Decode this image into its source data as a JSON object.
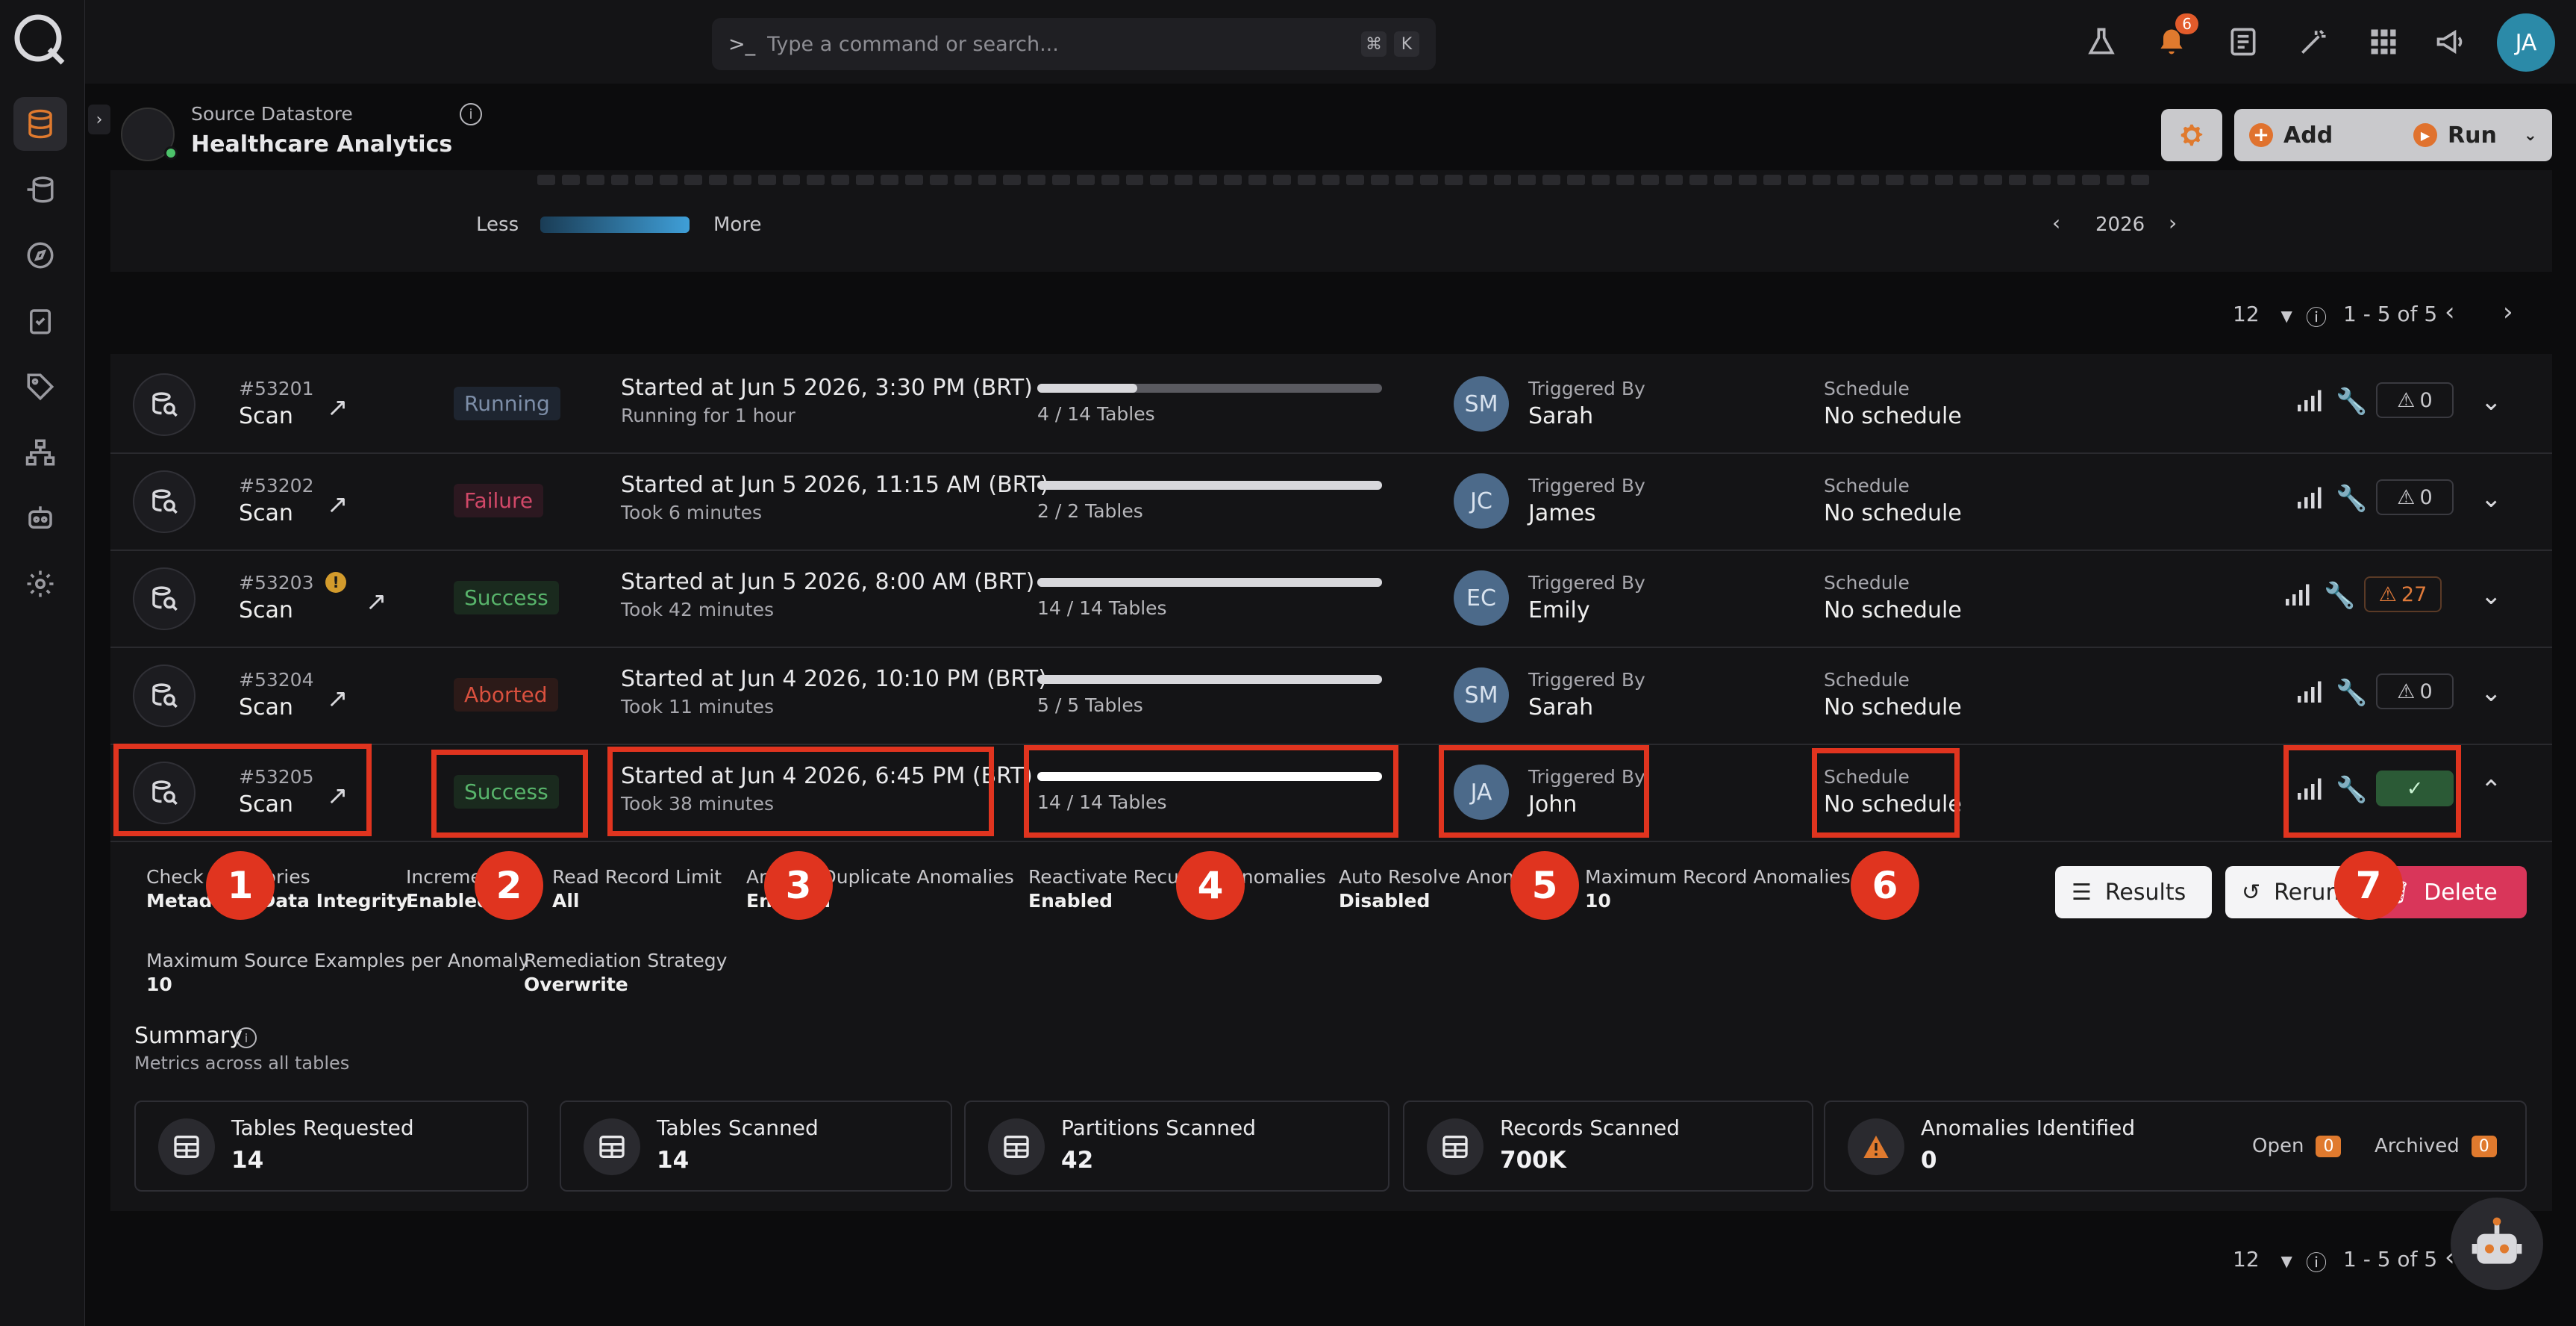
{
  "search": {
    "placeholder": "Type a command or search...",
    "kbd1": "⌘",
    "kbd2": "K"
  },
  "notifications": {
    "count": "6"
  },
  "user": {
    "initials": "JA"
  },
  "datastore": {
    "label": "Source Datastore",
    "name": "Healthcare Analytics"
  },
  "toolbar": {
    "add_label": "Add",
    "run_label": "Run"
  },
  "heatmap": {
    "less": "Less",
    "more": "More",
    "year": "2026"
  },
  "pager": {
    "page_size": "12",
    "range": "1 - 5 of 5"
  },
  "rows": [
    {
      "id": "#53201",
      "type": "Scan",
      "status": "Running",
      "started": "Started at Jun 5 2026, 3:30 PM (BRT)",
      "duration": "Running for 1 hour",
      "progress": 0.29,
      "tables": "4 / 14 Tables",
      "initials": "SM",
      "triggered_label": "Triggered By",
      "triggered_by": "Sarah",
      "schedule_label": "Schedule",
      "schedule": "No schedule",
      "anomalies": "0"
    },
    {
      "id": "#53202",
      "type": "Scan",
      "status": "Failure",
      "started": "Started at Jun 5 2026, 11:15 AM (BRT)",
      "duration": "Took 6 minutes",
      "progress": 1.0,
      "tables": "2 / 2 Tables",
      "initials": "JC",
      "triggered_label": "Triggered By",
      "triggered_by": "James",
      "schedule_label": "Schedule",
      "schedule": "No schedule",
      "anomalies": "0"
    },
    {
      "id": "#53203",
      "type": "Scan",
      "status": "Success",
      "started": "Started at Jun 5 2026, 8:00 AM (BRT)",
      "duration": "Took 42 minutes",
      "progress": 1.0,
      "tables": "14 / 14 Tables",
      "initials": "EC",
      "triggered_label": "Triggered By",
      "triggered_by": "Emily",
      "schedule_label": "Schedule",
      "schedule": "No schedule",
      "anomalies": "27"
    },
    {
      "id": "#53204",
      "type": "Scan",
      "status": "Aborted",
      "started": "Started at Jun 4 2026, 10:10 PM (BRT)",
      "duration": "Took 11 minutes",
      "progress": 1.0,
      "tables": "5 / 5 Tables",
      "initials": "SM",
      "triggered_label": "Triggered By",
      "triggered_by": "Sarah",
      "schedule_label": "Schedule",
      "schedule": "No schedule",
      "anomalies": "0"
    },
    {
      "id": "#53205",
      "type": "Scan",
      "status": "Success",
      "started": "Started at Jun 4 2026, 6:45 PM (BRT)",
      "duration": "Took 38 minutes",
      "progress": 1.0,
      "tables": "14 / 14 Tables",
      "initials": "JA",
      "triggered_label": "Triggered By",
      "triggered_by": "John",
      "schedule_label": "Schedule",
      "schedule": "No schedule",
      "anomalies": "✓"
    }
  ],
  "settings": [
    {
      "label": "Check Categories",
      "value": "Metadata, Data Integrity"
    },
    {
      "label": "Incremental",
      "value": "Enabled"
    },
    {
      "label": "Read Record Limit",
      "value": "All"
    },
    {
      "label": "Archive Duplicate Anomalies",
      "value": "Enabled"
    },
    {
      "label": "Reactivate Recurring Anomalies",
      "value": "Enabled"
    },
    {
      "label": "Auto Resolve Anomalies",
      "value": "Disabled"
    },
    {
      "label": "Maximum Record Anomalies per",
      "value": "10"
    },
    {
      "label": "Maximum Source Examples per Anomaly",
      "value": "10"
    },
    {
      "label": "Remediation Strategy",
      "value": "Overwrite"
    }
  ],
  "actions": {
    "results": "Results",
    "rerun": "Rerun",
    "delete": "Delete"
  },
  "summary": {
    "title": "Summary",
    "subtitle": "Metrics across all tables",
    "cards": [
      {
        "label": "Tables Requested",
        "value": "14"
      },
      {
        "label": "Tables Scanned",
        "value": "14"
      },
      {
        "label": "Partitions Scanned",
        "value": "42"
      },
      {
        "label": "Records Scanned",
        "value": "700K"
      },
      {
        "label": "Anomalies Identified",
        "value": "0"
      }
    ],
    "open_label": "Open",
    "open_count": "0",
    "archived_label": "Archived",
    "archived_count": "0"
  },
  "callouts": [
    "1",
    "2",
    "3",
    "4",
    "5",
    "6",
    "7"
  ],
  "colors": {
    "callout": "#e0341f",
    "accent_orange": "#e07a2e",
    "success": "#58b46b",
    "failure": "#d14868"
  }
}
